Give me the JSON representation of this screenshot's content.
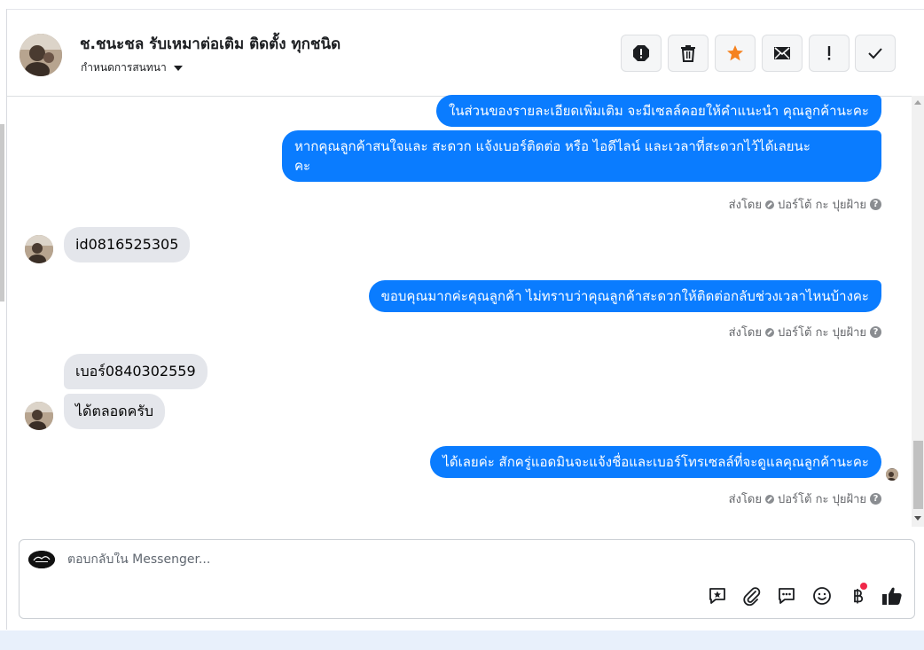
{
  "header": {
    "contact_name": "ช.ชนะชล รับเหมาต่อเติม ติดตั้ง ทุกชนิด",
    "subtitle": "กำหนดการสนทนา",
    "tools": [
      {
        "name": "report-icon"
      },
      {
        "name": "trash-icon"
      },
      {
        "name": "star-icon",
        "color": "#f5821f"
      },
      {
        "name": "mail-icon"
      },
      {
        "name": "exclamation-icon"
      },
      {
        "name": "check-icon"
      }
    ]
  },
  "messages": {
    "m1": "ในส่วนของรายละเอียดเพิ่มเติม จะมีเซลล์คอยให้คำแนะนำ คุณลูกค้านะคะ",
    "m2_line1": "หากคุณลูกค้าสนใจและ สะดวก แจ้งเบอร์ติดต่อ หรือ ไอดีไลน์ และเวลาที่สะดวกไว้ได้เลยนะ",
    "m2_line2": "คะ",
    "m3": "id0816525305",
    "m4": "ขอบคุณมากค่ะคุณลูกค้า ไม่ทราบว่าคุณลูกค้าสะดวกให้ติดต่อกลับช่วงเวลาไหนบ้างคะ",
    "m5": "เบอร์0840302559",
    "m6": "ได้ตลอดครับ",
    "m7": "ได้เลยค่ะ สักครู่แอดมินจะแจ้งชื่อและเบอร์โทรเซลล์ที่จะดูแลคุณลูกค้านะคะ",
    "sent_by_label": "ส่งโดย",
    "sender_name": "ปอร์โต้ กะ ปุยฝ้าย"
  },
  "composer": {
    "placeholder": "ตอบกลับใน Messenger...",
    "icons": [
      "saved-reply-icon",
      "attachment-icon",
      "chat-icon",
      "emoji-icon",
      "baht-icon",
      "like-icon"
    ]
  },
  "colors": {
    "outgoing_bubble": "#0a7cff",
    "incoming_bubble": "#e4e6eb",
    "star": "#f5821f",
    "notification_dot": "#f02849"
  }
}
